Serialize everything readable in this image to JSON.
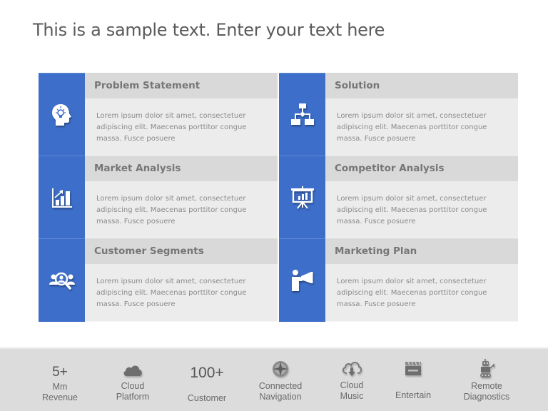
{
  "page": {
    "title": "This is a sample text. Enter your text here"
  },
  "colors": {
    "accent_blue": "#3d6ec9",
    "header_gray": "#d9d9d9",
    "body_gray": "#ececec",
    "footer_gray": "#dcdcdc"
  },
  "cards": [
    {
      "title": "Problem Statement",
      "icon": "head-lightbulb-icon",
      "body": "Lorem ipsum dolor sit amet, consectetuer adipiscing elit. Maecenas porttitor congue massa. Fusce posuere"
    },
    {
      "title": "Solution",
      "icon": "flowchart-icon",
      "body": "Lorem ipsum dolor sit amet, consectetuer adipiscing elit. Maecenas porttitor congue massa. Fusce posuere"
    },
    {
      "title": "Market Analysis",
      "icon": "bar-chart-growth-icon",
      "body": "Lorem ipsum dolor sit amet, consectetuer adipiscing elit. Maecenas porttitor congue massa. Fusce posuere"
    },
    {
      "title": "Competitor  Analysis",
      "icon": "presentation-board-icon",
      "body": "Lorem ipsum dolor sit amet, consectetuer adipiscing elit. Maecenas porttitor congue massa. Fusce posuere"
    },
    {
      "title": "Customer Segments",
      "icon": "people-search-icon",
      "body": "Lorem ipsum dolor sit amet, consectetuer adipiscing elit. Maecenas porttitor congue massa. Fusce posuere"
    },
    {
      "title": "Marketing  Plan",
      "icon": "megaphone-person-icon",
      "body": "Lorem ipsum dolor sit amet, consectetuer adipiscing elit. Maecenas porttitor congue massa. Fusce posuere"
    }
  ],
  "footer": {
    "items": [
      {
        "value": "5+",
        "line1": "Mm",
        "line2": "Revenue"
      },
      {
        "icon": "cloud-icon",
        "line1": "Cloud",
        "line2": "Platform"
      },
      {
        "value": "100+",
        "line1": "Customer"
      },
      {
        "icon": "compass-icon",
        "line1": "Connected",
        "line2": "Navigation"
      },
      {
        "icon": "cloud-download-icon",
        "line1": "Cloud",
        "line2": "Music"
      },
      {
        "icon": "clapperboard-icon",
        "line1": "Entertain"
      },
      {
        "icon": "robot-icon",
        "line1": "Remote",
        "line2": "Diagnostics"
      }
    ]
  }
}
